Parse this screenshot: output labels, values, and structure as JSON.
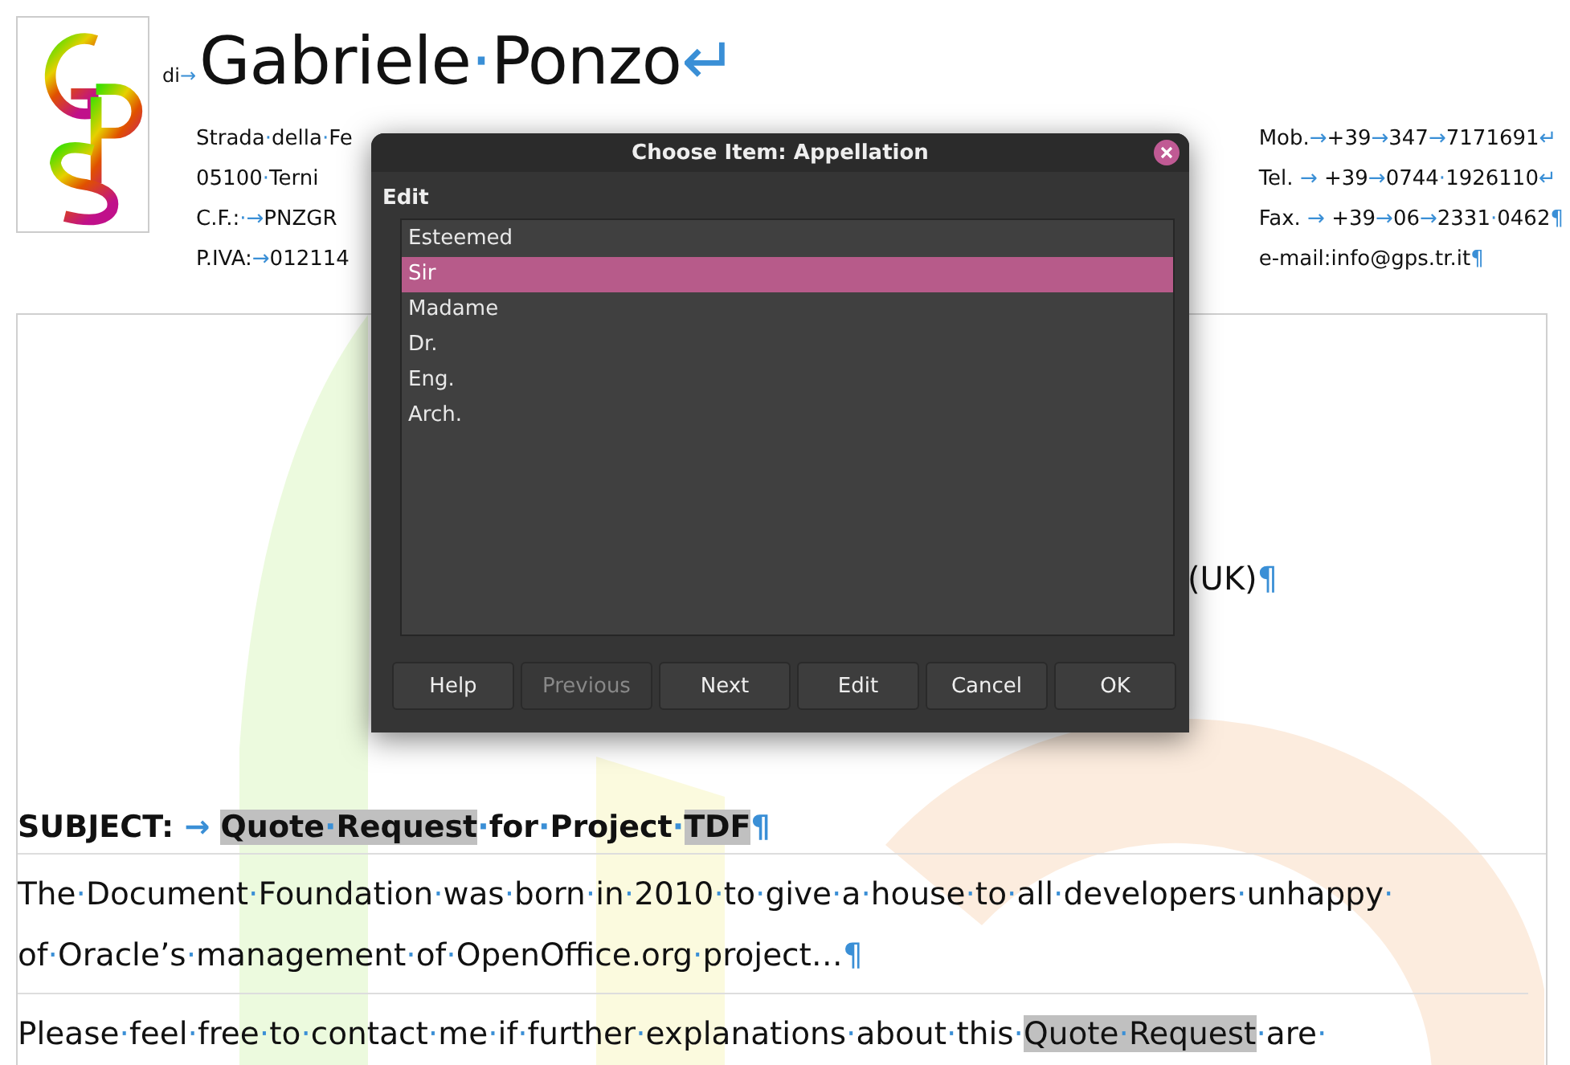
{
  "letterhead": {
    "prefix": "di→",
    "name": "Gabriele·Ponzo↵",
    "address": [
      "Strada·della·Fe",
      "05100·Terni",
      "C.F.:·→PNZGR",
      "P.IVA:→012114"
    ],
    "contacts": [
      "Mob.→+39→347→7171691↵",
      "Tel. → +39→0744·1926110↵",
      "Fax. → +39→06→2331·0462¶",
      "e-mail:info@gps.tr.it¶"
    ]
  },
  "document": {
    "country": "(UK)¶",
    "subject": [
      {
        "text": "SUBJECT:  →  ",
        "highlighted": false
      },
      {
        "text": "Quote·Request",
        "highlighted": true
      },
      {
        "text": "·for·Project·",
        "highlighted": false
      },
      {
        "text": "TDF",
        "highlighted": true
      },
      {
        "text": "¶",
        "highlighted": false
      }
    ],
    "paragraphs": [
      [
        {
          "text": "The·Document·Foundation·was·born·in·2010·to·give·a·house·to·all·developers·unhappy·of·Oracle’s·management·of·OpenOffice.org·project…¶",
          "highlighted": false
        }
      ],
      [
        {
          "text": "Please·feel·free·to·contact·me·if·further·explanations·about·this·",
          "highlighted": false
        },
        {
          "text": "Quote·Request",
          "highlighted": true
        },
        {
          "text": "·are·",
          "highlighted": false
        }
      ]
    ]
  },
  "dialog": {
    "title": "Choose Item: Appellation",
    "section": "Edit",
    "items": [
      {
        "label": "Esteemed",
        "selected": false
      },
      {
        "label": "Sir",
        "selected": true
      },
      {
        "label": "Madame",
        "selected": false
      },
      {
        "label": "Dr.",
        "selected": false
      },
      {
        "label": "Eng.",
        "selected": false
      },
      {
        "label": "Arch.",
        "selected": false
      }
    ],
    "buttons": [
      {
        "label": "Help",
        "disabled": false
      },
      {
        "label": "Previous",
        "disabled": true
      },
      {
        "label": "Next",
        "disabled": false
      },
      {
        "label": "Edit",
        "disabled": false
      },
      {
        "label": "Cancel",
        "disabled": false
      },
      {
        "label": "OK",
        "disabled": false
      }
    ]
  }
}
